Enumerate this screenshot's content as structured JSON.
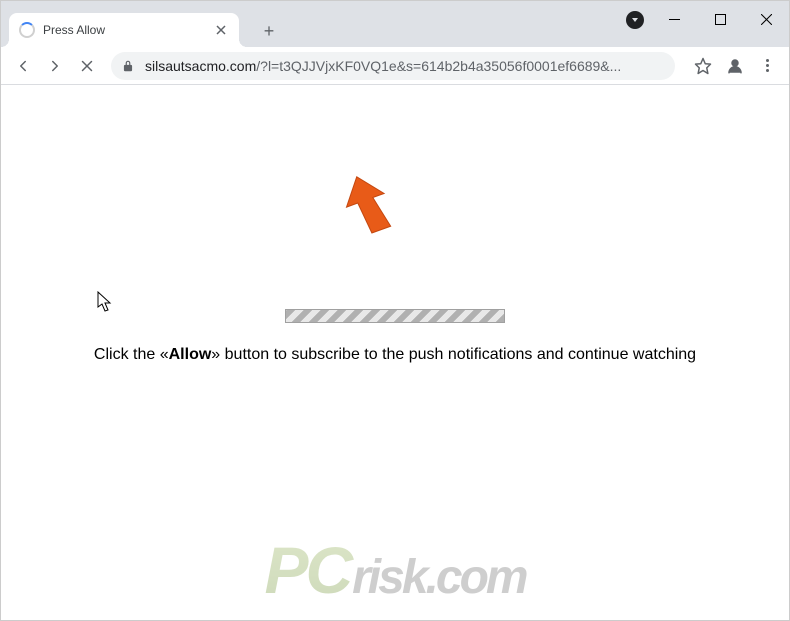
{
  "window": {
    "minimize_label": "Minimize",
    "maximize_label": "Maximize",
    "close_label": "Close"
  },
  "tab": {
    "title": "Press Allow",
    "loading": true
  },
  "navigation": {
    "back_label": "Back",
    "forward_label": "Forward",
    "stop_label": "Stop"
  },
  "address": {
    "host": "silsautsacmo.com",
    "path": "/?l=t3QJJVjxKF0VQ1e&s=614b2b4a35056f0001ef6689&...",
    "secure": true
  },
  "toolbar": {
    "bookmark_label": "Bookmark",
    "profile_label": "Profile",
    "menu_label": "Menu"
  },
  "page": {
    "message_prefix": "Click the «",
    "message_bold": "Allow",
    "message_suffix": "» button to subscribe to the push notifications and continue watching"
  },
  "watermark": {
    "brand_left": "PC",
    "brand_right": "risk.com"
  },
  "arrow": {
    "color": "#e85b18"
  }
}
